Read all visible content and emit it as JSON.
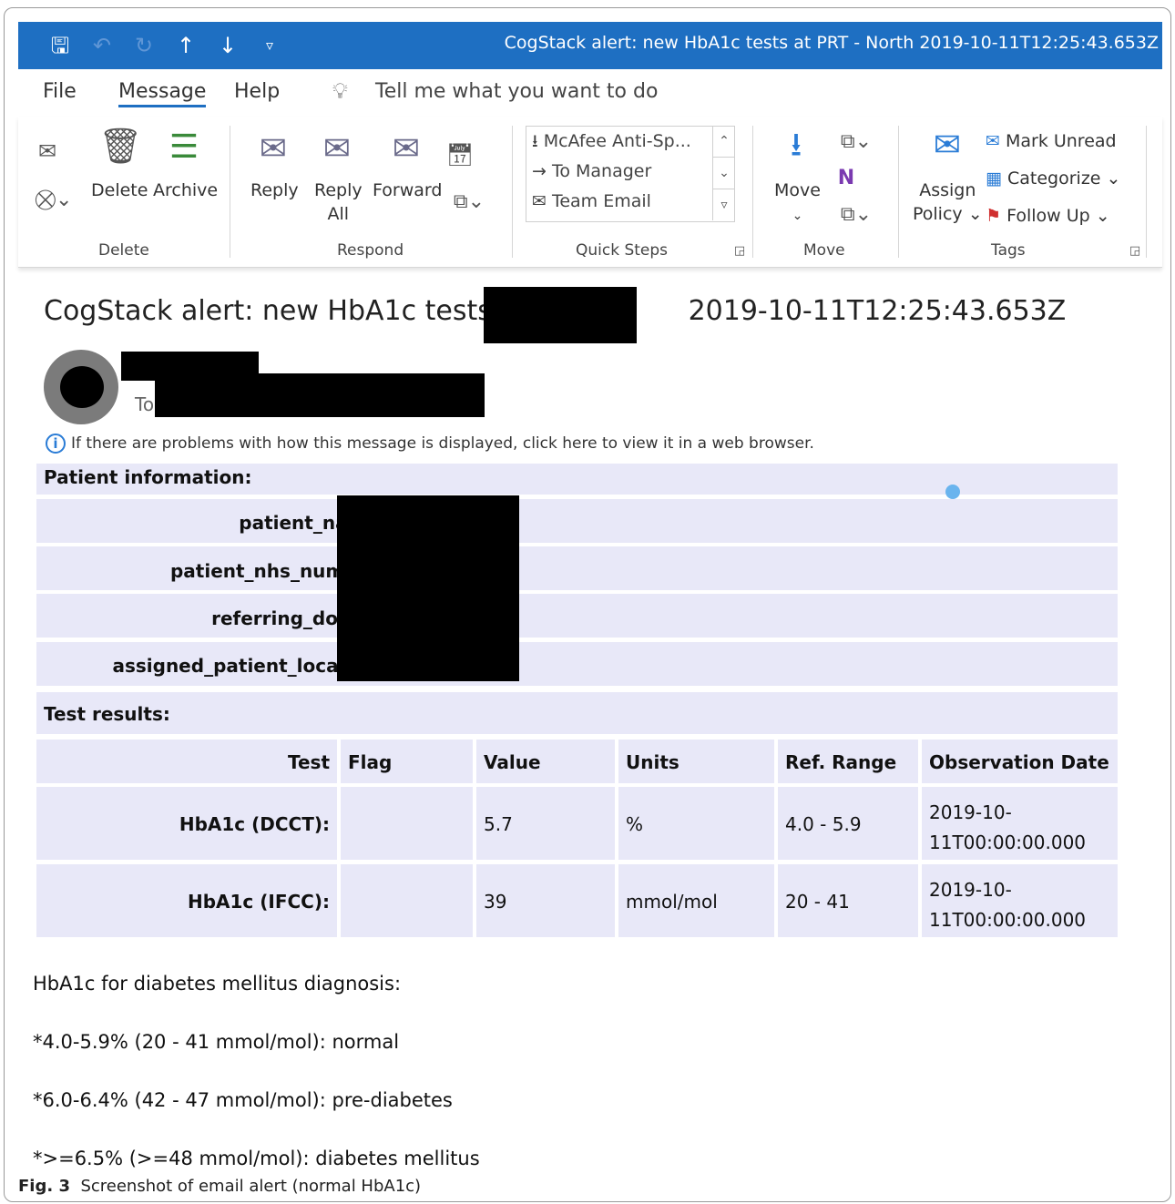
{
  "window": {
    "title": "CogStack alert: new HbA1c tests at PRT - North 2019-10-11T12:25:43.653Z",
    "qat_icons": [
      "save-icon",
      "undo-icon",
      "redo-icon",
      "up-arrow-icon",
      "down-arrow-icon",
      "customize-icon"
    ]
  },
  "tabs": {
    "file": "File",
    "message": "Message",
    "help": "Help",
    "tell_me": "Tell me what you want to do"
  },
  "ribbon": {
    "delete_group": {
      "delete": "Delete",
      "archive": "Archive",
      "label": "Delete"
    },
    "respond_group": {
      "reply": "Reply",
      "reply_all_1": "Reply",
      "reply_all_2": "All",
      "forward": "Forward",
      "label": "Respond"
    },
    "quick_steps": {
      "items": [
        "McAfee Anti-Sp...",
        "To Manager",
        "Team Email"
      ],
      "label": "Quick Steps"
    },
    "move_group": {
      "move": "Move",
      "label": "Move"
    },
    "tags_group": {
      "assign_1": "Assign",
      "assign_2": "Policy",
      "mark_unread": "Mark Unread",
      "categorize": "Categorize",
      "follow_up": "Follow Up",
      "label": "Tags"
    }
  },
  "message": {
    "subject_prefix": "CogStack alert: new HbA1c tests at",
    "subject_suffix": "2019-10-11T12:25:43.653Z",
    "to_label": "To",
    "info_bar": "If there are problems with how this message is displayed, click here to view it in a web browser."
  },
  "patient": {
    "heading": "Patient information:",
    "fields": [
      "patient_name:",
      "patient_nhs_number:",
      "referring_doctor:",
      "assigned_patient_location:"
    ]
  },
  "tests": {
    "heading": "Test results:",
    "columns": [
      "Test",
      "Flag",
      "Value",
      "Units",
      "Ref. Range",
      "Observation Date"
    ],
    "rows": [
      {
        "test": "HbA1c (DCCT):",
        "flag": "",
        "value": "5.7",
        "units": "%",
        "range": "4.0 - 5.9",
        "date_1": "2019-10-",
        "date_2": "11T00:00:00.000"
      },
      {
        "test": "HbA1c (IFCC):",
        "flag": "",
        "value": "39",
        "units": "mmol/mol",
        "range": "20 - 41",
        "date_1": "2019-10-",
        "date_2": "11T00:00:00.000"
      }
    ]
  },
  "notes": [
    "HbA1c for diabetes mellitus diagnosis:",
    "*4.0-5.9% (20 - 41 mmol/mol): normal",
    "*6.0-6.4% (42 - 47 mmol/mol): pre-diabetes",
    "*>=6.5% (>=48 mmol/mol): diabetes mellitus"
  ],
  "caption": {
    "label": "Fig. 3",
    "text": "Screenshot of email alert (normal HbA1c)"
  }
}
